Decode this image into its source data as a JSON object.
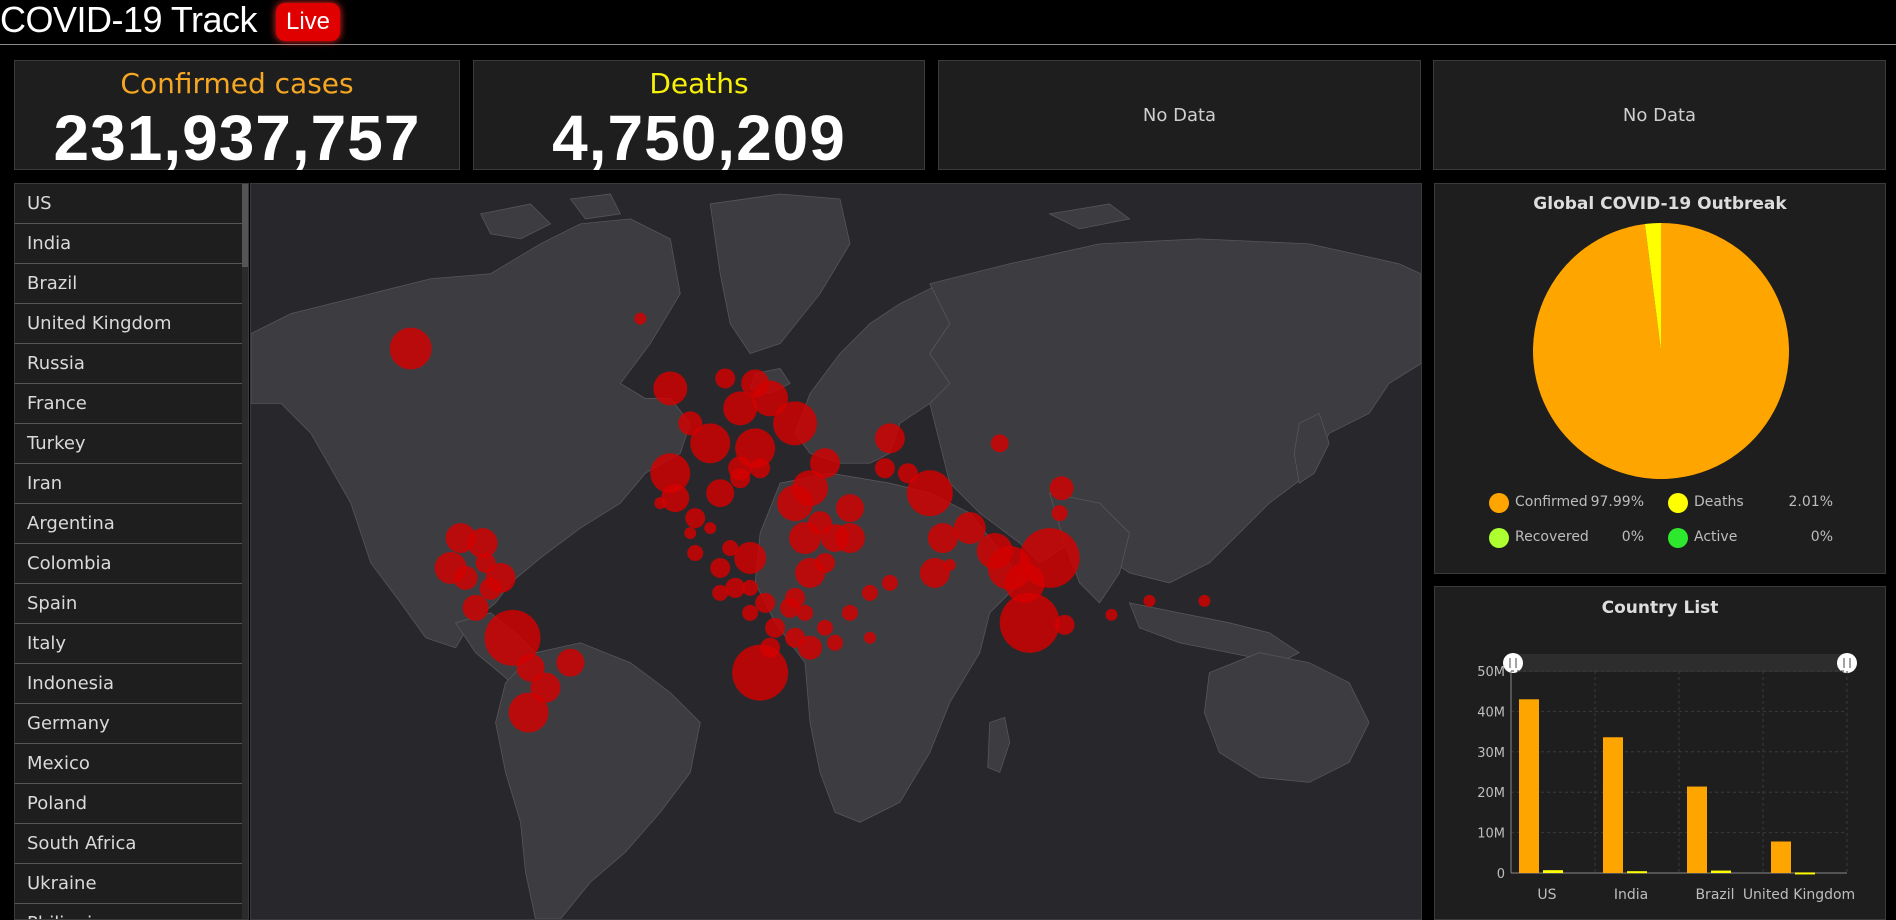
{
  "header": {
    "title": "COVID-19 Track",
    "live_badge": "Live"
  },
  "stats": {
    "confirmed": {
      "label": "Confirmed cases",
      "value": "231,937,757",
      "color": "#f5a623"
    },
    "deaths": {
      "label": "Deaths",
      "value": "4,750,209",
      "color": "#f7f00a"
    },
    "panel3": {
      "text": "No Data"
    },
    "panel4": {
      "text": "No Data"
    }
  },
  "country_list": [
    "US",
    "India",
    "Brazil",
    "United Kingdom",
    "Russia",
    "France",
    "Turkey",
    "Iran",
    "Argentina",
    "Colombia",
    "Spain",
    "Italy",
    "Indonesia",
    "Germany",
    "Mexico",
    "Poland",
    "South Africa",
    "Ukraine",
    "Philippines"
  ],
  "pie": {
    "title": "Global COVID-19 Outbreak",
    "legend": [
      {
        "name": "Confirmed",
        "pct": "97.99%",
        "color": "#ffa500"
      },
      {
        "name": "Deaths",
        "pct": "2.01%",
        "color": "#ffff00"
      },
      {
        "name": "Recovered",
        "pct": "0%",
        "color": "#adff2f"
      },
      {
        "name": "Active",
        "pct": "0%",
        "color": "#2ee82e"
      }
    ]
  },
  "chart_data": {
    "type": "bar",
    "title": "Country List",
    "categories": [
      "US",
      "India",
      "Brazil",
      "United Kingdom"
    ],
    "series": [
      {
        "values": [
          43000000,
          33600000,
          21400000,
          7800000
        ],
        "color": "#ffa500"
      },
      {
        "values": [
          700000,
          450000,
          600000,
          140000
        ],
        "color": "#ffff00"
      }
    ],
    "ylim": [
      0,
      50000000
    ],
    "yticks": [
      "0",
      "10M",
      "20M",
      "30M",
      "40M",
      "50M"
    ],
    "grid": true
  },
  "colors": {
    "map_land": "#3c3c40",
    "map_water": "#28282c",
    "bubble": "#d40000"
  }
}
